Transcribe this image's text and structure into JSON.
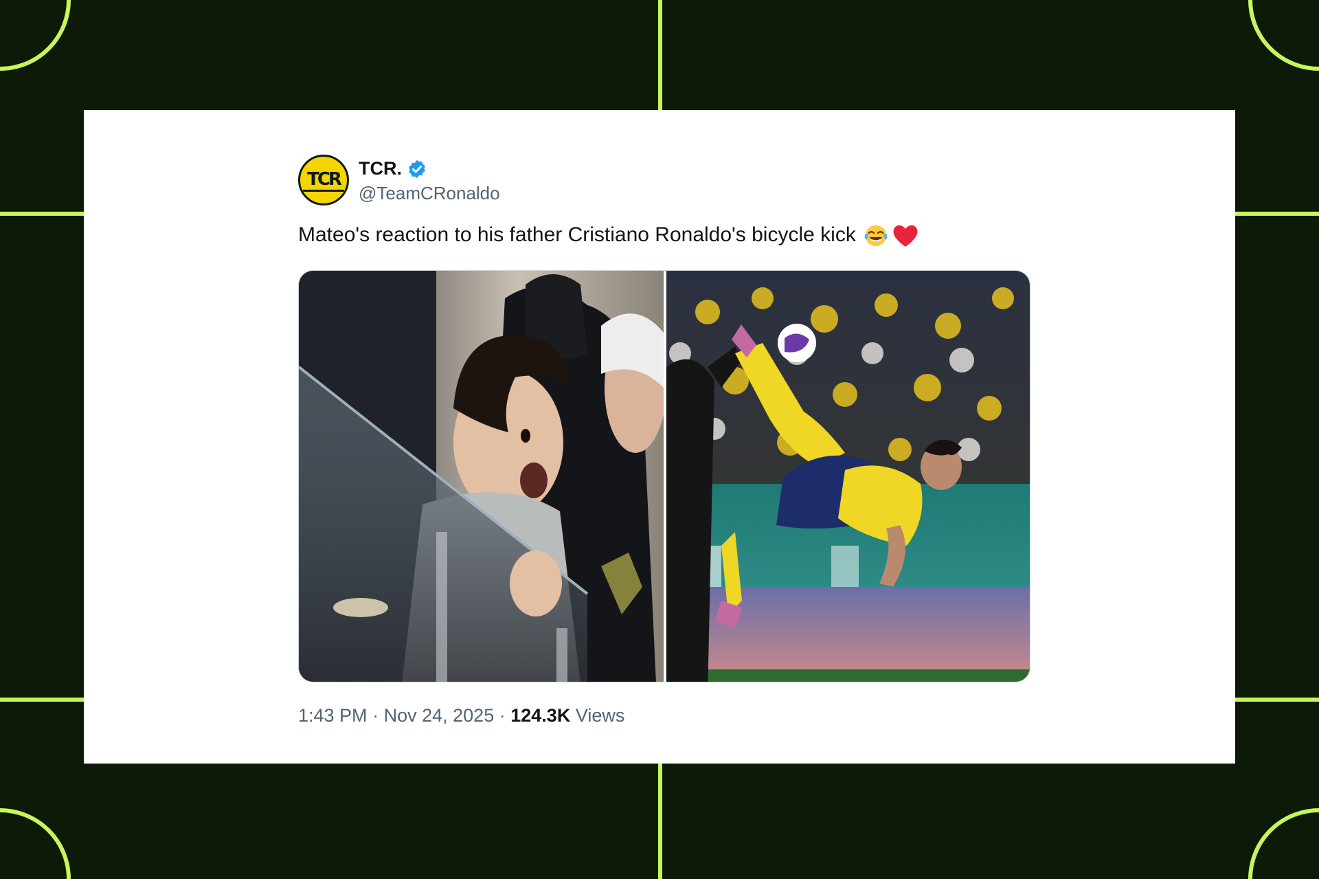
{
  "tweet": {
    "display_name": "TCR.",
    "handle": "@TeamCRonaldo",
    "avatar_text": "TCR",
    "text": "Mateo's reaction to his father Cristiano Ronaldo's bicycle kick",
    "emoji_1": "tears-of-joy-emoji",
    "emoji_2": "red-heart-emoji",
    "time": "1:43 PM",
    "separator": "·",
    "date": "Nov 24, 2025",
    "views_count": "124.3K",
    "views_label": "Views",
    "verified_icon": "verified-badge-icon",
    "verified_color": "#1d9bf0"
  },
  "media": {
    "left_photo": "boy-reaction-photo",
    "right_photo": "bicycle-kick-photo"
  },
  "colors": {
    "background": "#0d1a08",
    "pitch_lines": "#c8f55a",
    "card": "#ffffff",
    "text_primary": "#0f1419",
    "text_secondary": "#536471"
  }
}
